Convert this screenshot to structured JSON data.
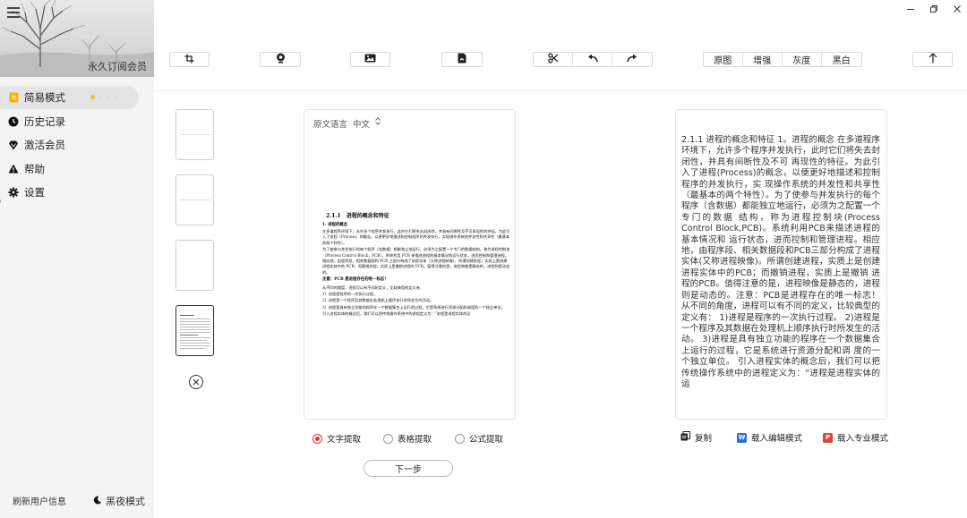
{
  "colors": {
    "accent": "#d9362b",
    "word_blue": "#2b6fd6",
    "pro_red": "#e0453a",
    "active_dot": "#f5c518"
  },
  "sidebar": {
    "vip_label": "永久订阅会员",
    "items": [
      {
        "label": "简易模式",
        "icon": "doc-icon"
      },
      {
        "label": "历史记录",
        "icon": "clock-icon"
      },
      {
        "label": "激活会员",
        "icon": "diamond-icon"
      },
      {
        "label": "帮助",
        "icon": "warning-icon"
      },
      {
        "label": "设置",
        "icon": "gear-icon"
      }
    ],
    "refresh_label": "刷新用户信息",
    "dark_mode_label": "黑夜模式"
  },
  "toolbar": {
    "view_modes": [
      "原图",
      "增强",
      "灰度",
      "黑白"
    ]
  },
  "image_panel": {
    "lang_label": "原文语言",
    "lang_value": "中文",
    "doc_title": "2.1.1　进程的概念和特征",
    "doc_sub1": "1. 进程的概念",
    "doc_p1": "在多道程序环境下，允许多个程序并发执行，此时它们将失去封闭性，并具有间断性及不可再现性的特征。为此引入了进程（Process）的概念，以便更好地描述和控制程序的并发执行，实现操作系统的并发性和共享性（最基本的两个特性）。",
    "doc_p2": "为了使参与并发执行的每个程序（含数据）都能独立地运行，必须为之配置一个专门的数据结构，称为进程控制块（Process Control Block，PCB）。系统利用 PCB 来描述进程的基本情况和运行状态，进而控制和管理进程。相应地，由程序段、相关数据段和 PCB 三部分构成了进程实体（又称进程映像）。所谓创建进程，实质上是创建进程实体中的 PCB；而撤销进程，实质上是撤销进程的 PCB。值得注意的是，进程映像是静态的，进程则是动态的。",
    "doc_note": "注意：PCB 是进程存在的唯一标志！",
    "doc_p3": "从不同的角度，进程可以有不同的定义，比较典型的定义有：",
    "doc_l1": "1）进程是程序的一次执行过程。",
    "doc_l2": "2）进程是一个程序及其数据在处理机上顺序执行时所发生的活动。",
    "doc_l3": "3）进程是具有独立功能的程序在一个数据集合上运行的过程，它是系统进行资源分配和调度的一个独立单位。",
    "doc_p4": "引入进程实体的概念后，我们可以把传统操作系统中的进程定义为：“进程是进程实体的运"
  },
  "ocr_text": "2.1.1 进程的概念和特征 1。进程的概念 在多道程序环境下，允许多个程序并发执行，此时它们将失去封闭性，并具有间断性及不可 再现性的特征。为此引入了进程(Process)的概念，以便更好地描述和控制程序的并发执行，实 现操作系统的并发性和共享性（最基本的两个特性）。为了使参与并发执行的每个程序（含数据）都能独立地运行，必须为之配置一个专门的数据 结构，称为进程控制块(Process Control Block,PCB)。系统利用PCB来描述进程的基本情况和 运行状态，进而控制和管理进程。相应地，由程序段、相关数据段和PCB三部分构成了进程实体(又称进程映像)。所谓创建进程，实质上是创建进程实体中的PCB；而撤销进程，实质上是撤销 进程的PCB。值得注意的是，进程映像是静态的，进程则是动态的。注意：PCB是进程存在的唯一标志！ 从不同的角度，进程可以有不同的定义，比较典型的定义有： 1)进程是程序的一次执行过程。 2)进程是一个程序及其数据在处理机上顺序执行时所发生的活动。 3)进程是具有独立功能的程序在一个数据集合上运行的过程，它是系统进行资源分配和调 度的一个独立单位。 引入进程实体的概念后，我们可以把传统操作系统中的进程定义为：“进程是进程实体的运",
  "extract_modes": [
    {
      "label": "文字提取",
      "selected": true
    },
    {
      "label": "表格提取",
      "selected": false
    },
    {
      "label": "公式提取",
      "selected": false
    }
  ],
  "next_label": "下一步",
  "actions": {
    "copy_label": "复制",
    "word_badge": "W",
    "word_label": "载入编辑模式",
    "pro_badge": "P",
    "pro_label": "载入专业模式"
  }
}
